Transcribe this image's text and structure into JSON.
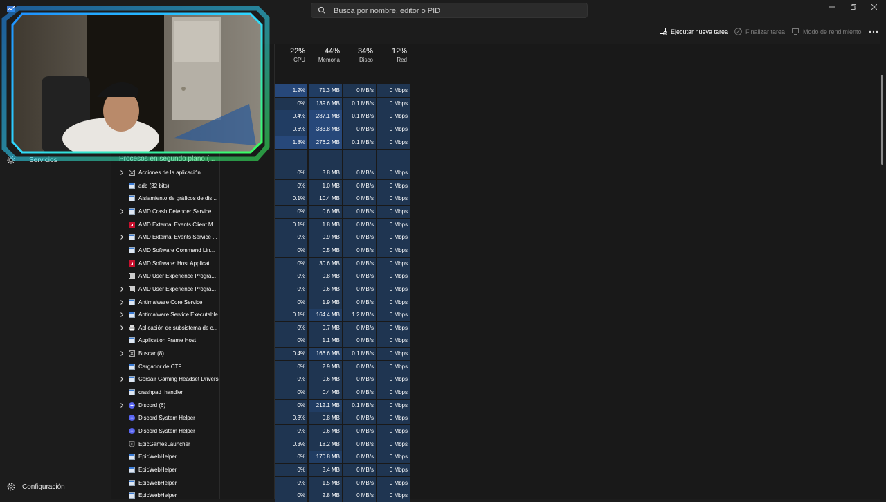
{
  "search": {
    "placeholder": "Busca por nombre, editor o PID"
  },
  "sidebar": {
    "services_label": "Servicios",
    "settings_label": "Configuración"
  },
  "toolbar": {
    "run_task_label": "Ejecutar nueva tarea",
    "end_task_label": "Finalizar tarea",
    "efficiency_label": "Modo de rendimiento"
  },
  "columns": {
    "cpu": {
      "pct": "22%",
      "label": "CPU"
    },
    "memory": {
      "pct": "44%",
      "label": "Memoria"
    },
    "disk": {
      "pct": "34%",
      "label": "Disco"
    },
    "network": {
      "pct": "12%",
      "label": "Red"
    }
  },
  "apps_rows": [
    {
      "cpu": "1.2%",
      "mem": "71.3 MB",
      "disk": "0 MB/s",
      "net": "0 Mbps",
      "cpuBg": 3,
      "memBg": 2,
      "diskBg": 1,
      "netBg": 1
    },
    {
      "cpu": "0%",
      "mem": "139.6 MB",
      "disk": "0.1 MB/s",
      "net": "0 Mbps",
      "cpuBg": 1,
      "memBg": 2,
      "diskBg": 1,
      "netBg": 1
    },
    {
      "cpu": "0.4%",
      "mem": "287.1 MB",
      "disk": "0.1 MB/s",
      "net": "0 Mbps",
      "cpuBg": 2,
      "memBg": 3,
      "diskBg": 1,
      "netBg": 1
    },
    {
      "cpu": "0.6%",
      "mem": "333.8 MB",
      "disk": "0 MB/s",
      "net": "0 Mbps",
      "cpuBg": 2,
      "memBg": 3,
      "diskBg": 1,
      "netBg": 1
    },
    {
      "cpu": "1.8%",
      "mem": "276.2 MB",
      "disk": "0.1 MB/s",
      "net": "0 Mbps",
      "cpuBg": 3,
      "memBg": 3,
      "diskBg": 1,
      "netBg": 1
    }
  ],
  "background_section_title": "Procesos en segundo plano (...",
  "processes": [
    {
      "name": "Acciones de la aplicación",
      "expandable": true,
      "icon": "generic-app-icon",
      "cpu": "0%",
      "mem": "3.8 MB",
      "disk": "0 MB/s",
      "net": "0 Mbps",
      "cpuBg": 1,
      "memBg": 1
    },
    {
      "name": "adb (32 bits)",
      "expandable": false,
      "icon": "window-app-icon",
      "cpu": "0%",
      "mem": "1.0 MB",
      "disk": "0 MB/s",
      "net": "0 Mbps",
      "cpuBg": 1,
      "memBg": 1
    },
    {
      "name": "Aislamiento de gráficos de dis...",
      "expandable": false,
      "icon": "window-app-icon",
      "cpu": "0.1%",
      "mem": "10.4 MB",
      "disk": "0 MB/s",
      "net": "0 Mbps",
      "cpuBg": 1,
      "memBg": 1
    },
    {
      "name": "AMD Crash Defender Service",
      "expandable": true,
      "icon": "window-app-icon",
      "cpu": "0%",
      "mem": "0.6 MB",
      "disk": "0 MB/s",
      "net": "0 Mbps",
      "cpuBg": 1,
      "memBg": 1
    },
    {
      "name": "AMD External Events Client M...",
      "expandable": false,
      "icon": "amd-icon",
      "cpu": "0.1%",
      "mem": "1.8 MB",
      "disk": "0 MB/s",
      "net": "0 Mbps",
      "cpuBg": 1,
      "memBg": 1
    },
    {
      "name": "AMD External Events Service ...",
      "expandable": true,
      "icon": "window-app-icon",
      "cpu": "0%",
      "mem": "0.9 MB",
      "disk": "0 MB/s",
      "net": "0 Mbps",
      "cpuBg": 1,
      "memBg": 1
    },
    {
      "name": "AMD Software Command Lin...",
      "expandable": false,
      "icon": "window-app-icon",
      "cpu": "0%",
      "mem": "0.5 MB",
      "disk": "0 MB/s",
      "net": "0 Mbps",
      "cpuBg": 1,
      "memBg": 1
    },
    {
      "name": "AMD Software: Host Applicati...",
      "expandable": false,
      "icon": "amd-icon",
      "cpu": "0%",
      "mem": "30.6 MB",
      "disk": "0 MB/s",
      "net": "0 Mbps",
      "cpuBg": 1,
      "memBg": 1
    },
    {
      "name": "AMD User Experience Progra...",
      "expandable": false,
      "icon": "grid-app-icon",
      "cpu": "0%",
      "mem": "0.8 MB",
      "disk": "0 MB/s",
      "net": "0 Mbps",
      "cpuBg": 1,
      "memBg": 1
    },
    {
      "name": "AMD User Experience Progra...",
      "expandable": true,
      "icon": "grid-app-icon",
      "cpu": "0%",
      "mem": "0.6 MB",
      "disk": "0 MB/s",
      "net": "0 Mbps",
      "cpuBg": 1,
      "memBg": 1
    },
    {
      "name": "Antimalware Core Service",
      "expandable": true,
      "icon": "window-app-icon",
      "cpu": "0%",
      "mem": "1.9 MB",
      "disk": "0 MB/s",
      "net": "0 Mbps",
      "cpuBg": 1,
      "memBg": 1
    },
    {
      "name": "Antimalware Service Executable",
      "expandable": true,
      "icon": "window-app-icon",
      "cpu": "0.1%",
      "mem": "164.4 MB",
      "disk": "1.2 MB/s",
      "net": "0 Mbps",
      "cpuBg": 1,
      "memBg": 2
    },
    {
      "name": "Aplicación de subsistema de c...",
      "expandable": true,
      "icon": "printer-icon",
      "cpu": "0%",
      "mem": "0.7 MB",
      "disk": "0 MB/s",
      "net": "0 Mbps",
      "cpuBg": 1,
      "memBg": 1
    },
    {
      "name": "Application Frame Host",
      "expandable": false,
      "icon": "window-app-icon",
      "cpu": "0%",
      "mem": "1.1 MB",
      "disk": "0 MB/s",
      "net": "0 Mbps",
      "cpuBg": 1,
      "memBg": 1
    },
    {
      "name": "Buscar (8)",
      "expandable": true,
      "icon": "generic-app-icon",
      "cpu": "0.4%",
      "mem": "166.6 MB",
      "disk": "0.1 MB/s",
      "net": "0 Mbps",
      "cpuBg": 1,
      "memBg": 2
    },
    {
      "name": "Cargador de CTF",
      "expandable": false,
      "icon": "window-app-icon",
      "cpu": "0%",
      "mem": "2.9 MB",
      "disk": "0 MB/s",
      "net": "0 Mbps",
      "cpuBg": 1,
      "memBg": 1
    },
    {
      "name": "Corsair Gaming Headset Drivers",
      "expandable": true,
      "icon": "window-app-icon",
      "cpu": "0%",
      "mem": "0.6 MB",
      "disk": "0 MB/s",
      "net": "0 Mbps",
      "cpuBg": 1,
      "memBg": 1
    },
    {
      "name": "crashpad_handler",
      "expandable": false,
      "icon": "window-app-icon",
      "cpu": "0%",
      "mem": "0.4 MB",
      "disk": "0 MB/s",
      "net": "0 Mbps",
      "cpuBg": 1,
      "memBg": 1
    },
    {
      "name": "Discord (6)",
      "expandable": true,
      "icon": "discord-icon",
      "cpu": "0%",
      "mem": "212.1 MB",
      "disk": "0.1 MB/s",
      "net": "0 Mbps",
      "cpuBg": 1,
      "memBg": 2
    },
    {
      "name": "Discord System Helper",
      "expandable": false,
      "icon": "discord-icon",
      "cpu": "0.3%",
      "mem": "0.8 MB",
      "disk": "0 MB/s",
      "net": "0 Mbps",
      "cpuBg": 1,
      "memBg": 1
    },
    {
      "name": "Discord System Helper",
      "expandable": false,
      "icon": "discord-icon",
      "cpu": "0%",
      "mem": "0.6 MB",
      "disk": "0 MB/s",
      "net": "0 Mbps",
      "cpuBg": 1,
      "memBg": 1
    },
    {
      "name": "EpicGamesLauncher",
      "expandable": false,
      "icon": "epic-icon",
      "cpu": "0.3%",
      "mem": "18.2 MB",
      "disk": "0 MB/s",
      "net": "0 Mbps",
      "cpuBg": 1,
      "memBg": 1
    },
    {
      "name": "EpicWebHelper",
      "expandable": false,
      "icon": "window-app-icon",
      "cpu": "0%",
      "mem": "170.8 MB",
      "disk": "0 MB/s",
      "net": "0 Mbps",
      "cpuBg": 1,
      "memBg": 2
    },
    {
      "name": "EpicWebHelper",
      "expandable": false,
      "icon": "window-app-icon",
      "cpu": "0%",
      "mem": "3.4 MB",
      "disk": "0 MB/s",
      "net": "0 Mbps",
      "cpuBg": 1,
      "memBg": 1
    },
    {
      "name": "EpicWebHelper",
      "expandable": false,
      "icon": "window-app-icon",
      "cpu": "0%",
      "mem": "1.5 MB",
      "disk": "0 MB/s",
      "net": "0 Mbps",
      "cpuBg": 1,
      "memBg": 1
    },
    {
      "name": "EpicWebHelper",
      "expandable": false,
      "icon": "window-app-icon",
      "cpu": "0%",
      "mem": "2.8 MB",
      "disk": "0 MB/s",
      "net": "0 Mbps",
      "cpuBg": 1,
      "memBg": 1
    }
  ],
  "colors": {
    "background": "#191919",
    "heat_low": "#1f3551",
    "heat_mid": "#213d63",
    "heat_high": "#27487a",
    "webcam_glow": "#2fd9ff",
    "webcam_glow_green": "#39ff5a"
  }
}
